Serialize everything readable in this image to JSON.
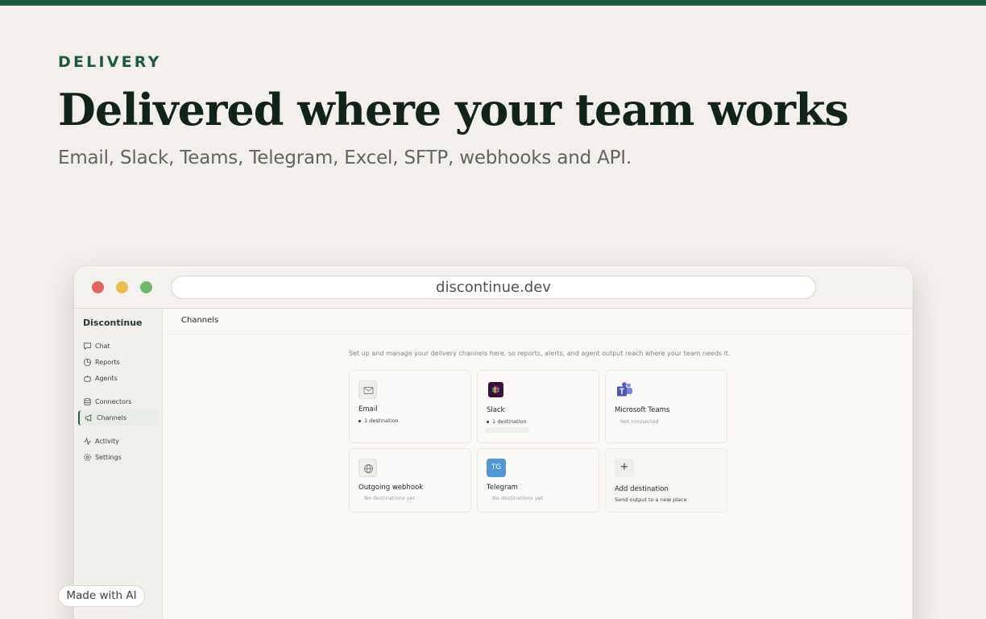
{
  "hero": {
    "eyebrow": "DELIVERY",
    "headline": "Delivered where your team works",
    "subhead": "Email, Slack, Teams, Telegram, Excel, SFTP, webhooks and API."
  },
  "browser": {
    "url": "discontinue.dev"
  },
  "app": {
    "brand": "Discontinue",
    "nav": [
      {
        "label": "Chat",
        "icon": "chat-icon"
      },
      {
        "label": "Reports",
        "icon": "pie-chart-icon"
      },
      {
        "label": "Agents",
        "icon": "robot-icon"
      },
      {
        "label": "Connectors",
        "icon": "database-icon"
      },
      {
        "label": "Channels",
        "icon": "megaphone-icon",
        "active": true
      },
      {
        "label": "Activity",
        "icon": "activity-icon"
      },
      {
        "label": "Settings",
        "icon": "gear-icon"
      }
    ],
    "page_title": "Channels",
    "intro": "Set up and manage your delivery channels here, so reports, alerts, and agent output reach where your team needs it.",
    "cards": [
      {
        "title": "Email",
        "status": "1 destination",
        "icon": "mail-icon"
      },
      {
        "title": "Slack",
        "status": "1 destination",
        "icon": "slack-icon"
      },
      {
        "title": "Microsoft Teams",
        "status": "Not connected",
        "icon": "teams-icon"
      },
      {
        "title": "Outgoing webhook",
        "status": "No destinations yet",
        "icon": "globe-icon"
      },
      {
        "title": "Telegram",
        "status": "No destinations yet",
        "badge": "TG",
        "icon": "telegram-icon"
      },
      {
        "title": "Add destination",
        "status": "Send output to a new place",
        "badge": "+",
        "icon": "plus-icon"
      }
    ]
  },
  "footer": {
    "made_with": "Made with AI"
  },
  "colors": {
    "accent": "#1e5a3f",
    "background": "#f3f0eb",
    "telegram": "#4f97d6"
  }
}
